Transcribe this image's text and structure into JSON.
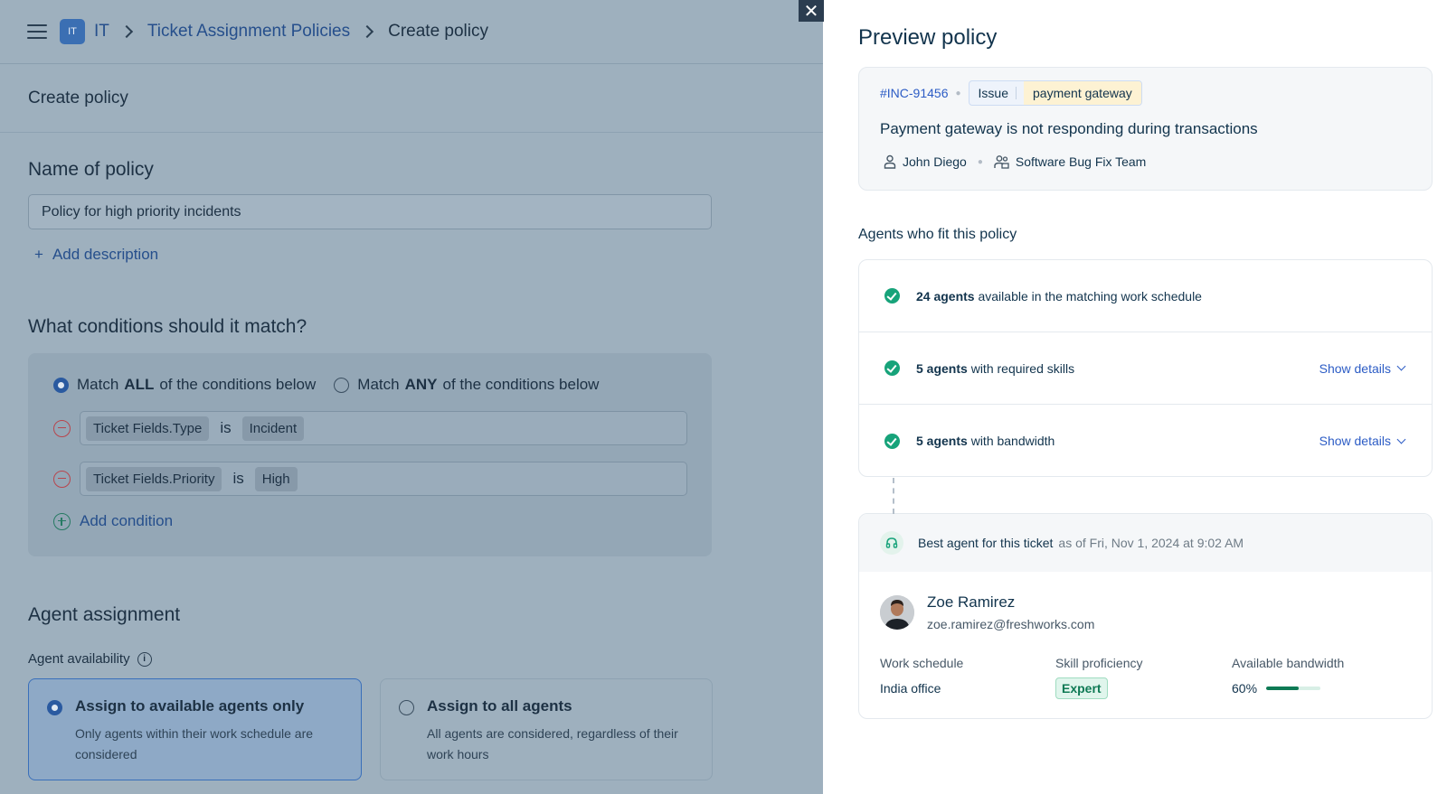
{
  "breadcrumb": {
    "app_badge": "IT",
    "root": "IT",
    "section": "Ticket Assignment Policies",
    "current": "Create policy"
  },
  "form": {
    "header": "Create policy",
    "name_heading": "Name of policy",
    "name_value": "Policy for high priority incidents",
    "add_description": "Add description",
    "conditions_heading": "What conditions should it match?",
    "match_all_pre": "Match",
    "match_all_key": "ALL",
    "match_all_post": "of the conditions below",
    "match_any_pre": "Match",
    "match_any_key": "ANY",
    "match_any_post": "of the conditions below",
    "match_selected": "ALL",
    "conditions": [
      {
        "field": "Ticket Fields.Type",
        "operator": "is",
        "value": "Incident"
      },
      {
        "field": "Ticket Fields.Priority",
        "operator": "is",
        "value": "High"
      }
    ],
    "add_condition": "Add condition",
    "assignment_heading": "Agent assignment",
    "availability_label": "Agent availability",
    "options": [
      {
        "title": "Assign to available agents only",
        "subtitle": "Only agents within their work schedule are considered",
        "selected": true
      },
      {
        "title": "Assign to all agents",
        "subtitle": "All agents are considered, regardless of their work hours",
        "selected": false
      }
    ]
  },
  "preview": {
    "title": "Preview policy",
    "ticket": {
      "id": "#INC-91456",
      "type": "Issue",
      "category": "payment gateway",
      "subject": "Payment gateway is not responding during transactions",
      "requester": "John Diego",
      "group": "Software Bug Fix Team"
    },
    "agents_heading": "Agents who fit this policy",
    "fit_rows": [
      {
        "count": "24 agents",
        "text": "available in the matching work schedule",
        "action": ""
      },
      {
        "count": "5 agents",
        "text": "with required skills",
        "action": "Show details"
      },
      {
        "count": "5 agents",
        "text": "with bandwidth",
        "action": "Show details"
      }
    ],
    "best": {
      "label": "Best agent for this ticket",
      "timestamp": "as of Fri, Nov 1, 2024 at 9:02 AM",
      "name": "Zoe Ramirez",
      "email": "zoe.ramirez@freshworks.com",
      "work_schedule_label": "Work schedule",
      "work_schedule": "India office",
      "skill_label": "Skill proficiency",
      "skill": "Expert",
      "bandwidth_label": "Available bandwidth",
      "bandwidth": "60%",
      "bandwidth_fraction": 0.6
    }
  },
  "colors": {
    "accent": "#2c5cc5",
    "success": "#17a37a",
    "overlay": "#9eb0be"
  },
  "icons": [
    "menu-icon",
    "chevron-right-icon",
    "plus-icon",
    "minus-circle-icon",
    "plus-circle-icon",
    "info-icon",
    "close-icon",
    "user-icon",
    "team-icon",
    "check-circle-icon",
    "chevron-down-icon",
    "headset-icon"
  ]
}
